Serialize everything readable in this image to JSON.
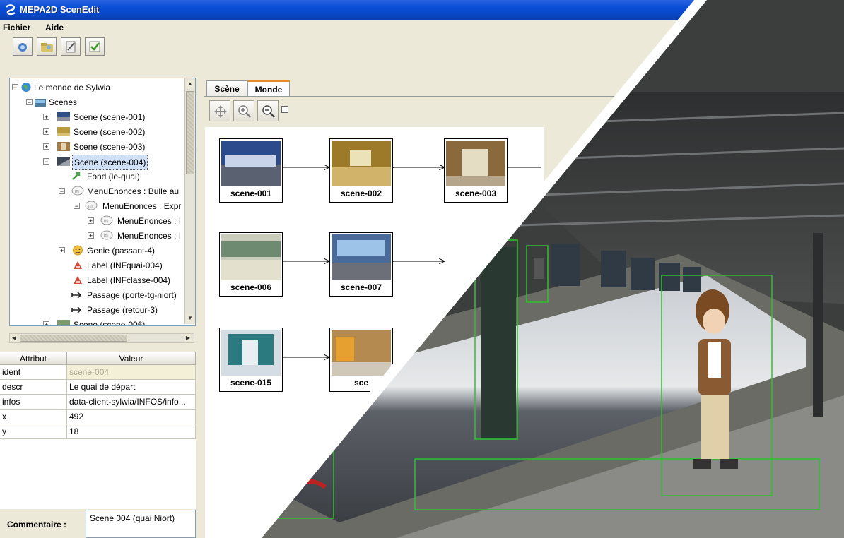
{
  "window": {
    "title": "MEPA2D ScenEdit"
  },
  "menu": [
    "Fichier",
    "Aide"
  ],
  "tree": {
    "items": [
      {
        "label": "Le monde de Sylwia",
        "icon": "globe-icon"
      },
      {
        "label": "Scenes",
        "icon": "scenes-folder-icon"
      },
      {
        "label": "Scene (scene-001)",
        "icon": "scene-thumb-icon"
      },
      {
        "label": "Scene (scene-002)",
        "icon": "scene-thumb-icon"
      },
      {
        "label": "Scene (scene-003)",
        "icon": "scene-thumb-icon"
      },
      {
        "label": "Scene (scene-004)",
        "icon": "scene-thumb-icon"
      },
      {
        "label": "Fond (le-quai)",
        "icon": "arrow-icon"
      },
      {
        "label": "MenuEnonces : Bulle au",
        "icon": "menu-bubble-icon"
      },
      {
        "label": "MenuEnonces : Expr",
        "icon": "menu-bubble-icon"
      },
      {
        "label": "MenuEnonces : I",
        "icon": "menu-bubble-icon"
      },
      {
        "label": "MenuEnonces : I",
        "icon": "menu-bubble-icon"
      },
      {
        "label": "Genie (passant-4)",
        "icon": "genie-face-icon"
      },
      {
        "label": "Label (INFquai-004)",
        "icon": "label-icon"
      },
      {
        "label": "Label (INFclasse-004)",
        "icon": "label-icon"
      },
      {
        "label": "Passage (porte-tg-niort)",
        "icon": "passage-arrow-icon"
      },
      {
        "label": "Passage (retour-3)",
        "icon": "passage-arrow-icon"
      },
      {
        "label": "Scene (scene-006)",
        "icon": "scene-thumb-icon"
      }
    ]
  },
  "attributes": {
    "headers": [
      "Attribut",
      "Valeur"
    ],
    "rows": [
      [
        "ident",
        "scene-004"
      ],
      [
        "descr",
        "Le quai de départ"
      ],
      [
        "infos",
        "data-client-sylwia/INFOS/info..."
      ],
      [
        "x",
        "492"
      ],
      [
        "y",
        "18"
      ]
    ]
  },
  "comment": {
    "label": "Commentaire :",
    "value": "Scene 004 (quai Niort)"
  },
  "tabs": [
    "Scène",
    "Monde"
  ],
  "active_tab": "Monde",
  "scenes": [
    "scene-001",
    "scene-002",
    "scene-003",
    "scene-006",
    "scene-007",
    "scene-015",
    "sce"
  ]
}
